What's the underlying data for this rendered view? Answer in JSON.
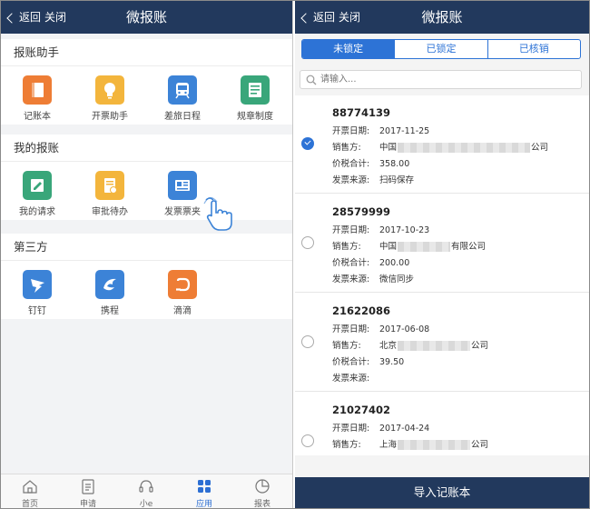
{
  "left": {
    "header": {
      "back_label": "返回",
      "close_label": "关闭",
      "title": "微报账"
    },
    "sections": [
      {
        "title": "报账助手",
        "items": [
          {
            "label": "记账本",
            "icon": "notebook-icon",
            "color": "#ee7d35"
          },
          {
            "label": "开票助手",
            "icon": "lightbulb-icon",
            "color": "#f3b53c"
          },
          {
            "label": "差旅日程",
            "icon": "train-icon",
            "color": "#3c83d7"
          },
          {
            "label": "规章制度",
            "icon": "document-list-icon",
            "color": "#39a67a"
          }
        ]
      },
      {
        "title": "我的报账",
        "items": [
          {
            "label": "我的请求",
            "icon": "edit-icon",
            "color": "#39a67a"
          },
          {
            "label": "审批待办",
            "icon": "approval-icon",
            "color": "#f3b53c"
          },
          {
            "label": "发票票夹",
            "icon": "invoice-folder-icon",
            "color": "#3c83d7"
          }
        ]
      },
      {
        "title": "第三方",
        "items": [
          {
            "label": "钉钉",
            "icon": "dingtalk-icon",
            "color": "#3c83d7"
          },
          {
            "label": "携程",
            "icon": "ctrip-icon",
            "color": "#3c83d7"
          },
          {
            "label": "滴滴",
            "icon": "didi-icon",
            "color": "#ee7d35"
          }
        ]
      }
    ],
    "tabbar": [
      {
        "label": "首页",
        "icon": "home-icon"
      },
      {
        "label": "申请",
        "icon": "clipboard-icon"
      },
      {
        "label": "小e",
        "icon": "headset-icon"
      },
      {
        "label": "应用",
        "icon": "apps-icon",
        "active": true
      },
      {
        "label": "报表",
        "icon": "pie-chart-icon"
      }
    ]
  },
  "right": {
    "header": {
      "back_label": "返回",
      "close_label": "关闭",
      "title": "微报账"
    },
    "segments": [
      {
        "label": "未锁定",
        "active": true
      },
      {
        "label": "已锁定",
        "active": false
      },
      {
        "label": "已核销",
        "active": false
      }
    ],
    "search": {
      "placeholder": "请输入..."
    },
    "field_labels": {
      "date": "开票日期:",
      "seller": "销售方:",
      "total": "价税合计:",
      "source": "发票来源:"
    },
    "invoices": [
      {
        "number": "88774139",
        "date": "2017-11-25",
        "seller_prefix": "中国",
        "seller_suffix": "公司",
        "total": "358.00",
        "source": "扫码保存",
        "checked": true
      },
      {
        "number": "28579999",
        "date": "2017-10-23",
        "seller_prefix": "中国",
        "seller_suffix": "有限公司",
        "total": "200.00",
        "source": "微信同步",
        "checked": false
      },
      {
        "number": "21622086",
        "date": "2017-06-08",
        "seller_prefix": "北京",
        "seller_suffix": "公司",
        "total": "39.50",
        "source": "",
        "checked": false
      },
      {
        "number": "21027402",
        "date": "2017-04-24",
        "seller_prefix": "上海",
        "seller_suffix": "公司",
        "total": "",
        "source": "",
        "checked": false
      }
    ],
    "import_button": "导入记账本"
  },
  "colors": {
    "header": "#22395d",
    "accent": "#2d73d6"
  }
}
